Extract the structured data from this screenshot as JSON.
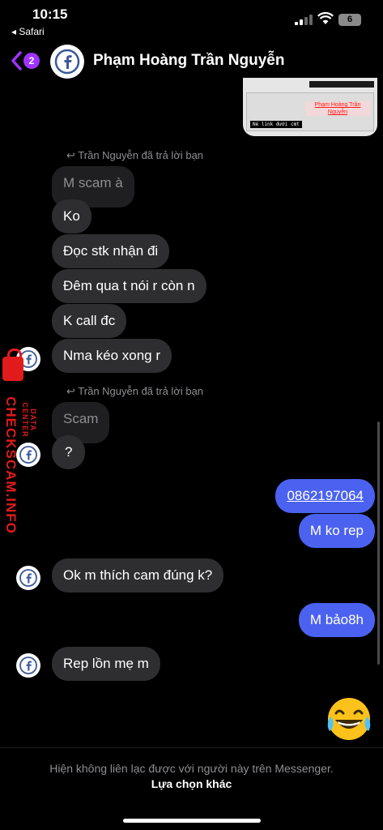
{
  "status": {
    "time": "10:15",
    "back_app": "◂ Safari",
    "battery": "6"
  },
  "header": {
    "unread_count": "2",
    "contact_name": "Phạm Hoàng Trần Nguyễn"
  },
  "story_preview": {
    "name_tag": "Phạm Hoàng Trần Nguyễn",
    "caption": "Né link dưới cmt"
  },
  "replies": [
    {
      "label": "Trần Nguyễn đã trả lời bạn",
      "quoted": "M scam à"
    },
    {
      "label": "Trần Nguyễn đã trả lời bạn",
      "quoted": "Scam"
    }
  ],
  "messages": {
    "in_1": "Ko",
    "in_2": "Đọc stk nhận đi",
    "in_3": "Đêm qua t nói r còn n",
    "in_4": "K call đc",
    "in_5": "Nma kéo xong r",
    "in_6": "?",
    "out_1": "0862197064",
    "out_2": "M ko rep",
    "in_7": "Ok m thích cam đúng k?",
    "out_3": "M bảo8h",
    "in_8": "Rep lồn mẹ m"
  },
  "watermark": {
    "brand": "CHECKSCAM.INFO",
    "sub": "DATA CENTER"
  },
  "footer": {
    "note": "Hiện không liên lạc được với người này trên Messenger.",
    "action": "Lựa chọn khác"
  },
  "colors": {
    "outgoing": "#4b62f0",
    "incoming": "#2e2e30",
    "badge": "#a033ff",
    "watermark": "#e11b1b"
  }
}
